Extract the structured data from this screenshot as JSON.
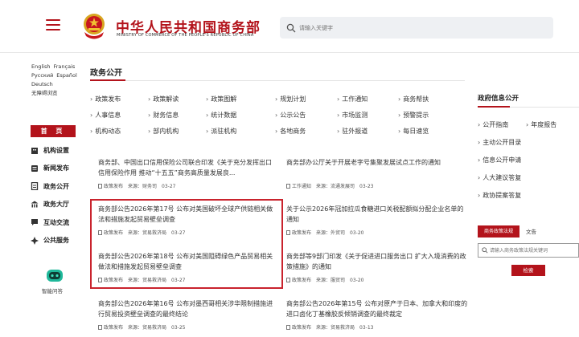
{
  "header": {
    "title": "中华人民共和国商务部",
    "subtitle": "MINISTRY OF COMMERCE OF THE PEOPLE'S REPUBLIC OF CHINA",
    "search_placeholder": "请输入关键字",
    "brand_color": "#b3131b"
  },
  "languages": {
    "row1": [
      "English",
      "Français"
    ],
    "row2": [
      "Русский",
      "Español"
    ],
    "row3": [
      "Deutsch"
    ],
    "accessibility": "无障碍浏览"
  },
  "sidebar": {
    "home": "首 页",
    "items": [
      {
        "label": "机构设置",
        "icon": "building-icon"
      },
      {
        "label": "新闻发布",
        "icon": "newspaper-icon"
      },
      {
        "label": "政务公开",
        "icon": "document-icon"
      },
      {
        "label": "政务大厅",
        "icon": "hall-icon"
      },
      {
        "label": "互动交流",
        "icon": "chat-icon"
      },
      {
        "label": "公共服务",
        "icon": "services-icon"
      }
    ],
    "assistant": "智能问答"
  },
  "main": {
    "section_title": "政务公开",
    "categories": [
      [
        "政策发布",
        "政策解读",
        "政策图解",
        "规划计划",
        "工作通知",
        "商务帮扶"
      ],
      [
        "人事信息",
        "财务信息",
        "统计数据",
        "公示公告",
        "市场监测",
        "预警提示"
      ],
      [
        "机构动态",
        "部内机构",
        "派驻机构",
        "各地商务",
        "驻外报道",
        "每日速览"
      ]
    ],
    "news": [
      {
        "title": "商务部、中国出口信用保险公司联合印发《关于充分发挥出口信用保险作用 推动“十五五”商务高质量发展良...",
        "category": "政策发布",
        "source": "来源：财务司",
        "date": "03-27"
      },
      {
        "title": "商务部办公厅关于开展老字号集聚发展试点工作的通知",
        "category": "工作通知",
        "source": "来源：流通发展司",
        "date": "03-23"
      },
      {
        "title": "商务部公告2026年第17号 公布对美国破坏全球产供链相关做法和措施发起贸易壁垒调查",
        "category": "政策发布",
        "source": "来源：贸易救济局",
        "date": "03-27"
      },
      {
        "title": "关于公示2026年冠加拉瓜食糖进口关税配额拟分配企业名单的通知",
        "category": "政策发布",
        "source": "来源：外贸司",
        "date": "03-20"
      },
      {
        "title": "商务部公告2026年第18号 公布对美国阻碍绿色产品贸易相关做法和措施发起贸易壁垒调查",
        "category": "政策发布",
        "source": "来源：贸易救济局",
        "date": "03-27"
      },
      {
        "title": "商务部等9部门印发《关于促进进口服务出口 扩大入境消费的政策措施》的通知",
        "category": "政策发布",
        "source": "来源：服贸司",
        "date": "03-20"
      },
      {
        "title": "商务部公告2026年第16号 公布对墨西哥相关涉华限制措施进行贸易投资壁垒调查的最终结论",
        "category": "政策发布",
        "source": "来源：贸易救济局",
        "date": "03-25"
      },
      {
        "title": "商务部公告2026年第15号 公布对原产于日本、加拿大和印度的进口卤化丁基橡胶反倾销调查的最终裁定",
        "category": "政策发布",
        "source": "来源：贸易救济局",
        "date": "03-13"
      }
    ]
  },
  "right": {
    "title": "政府信息公开",
    "links": [
      "公开指南",
      "年度报告",
      "主动公开目录",
      "信息公开申请",
      "人大建议答复",
      "政协提案答复"
    ],
    "policy_tab": "商务政策法规",
    "policy_tab2": "文告",
    "policy_placeholder": "请输入商务政策法规关键词",
    "policy_search": "检索"
  }
}
